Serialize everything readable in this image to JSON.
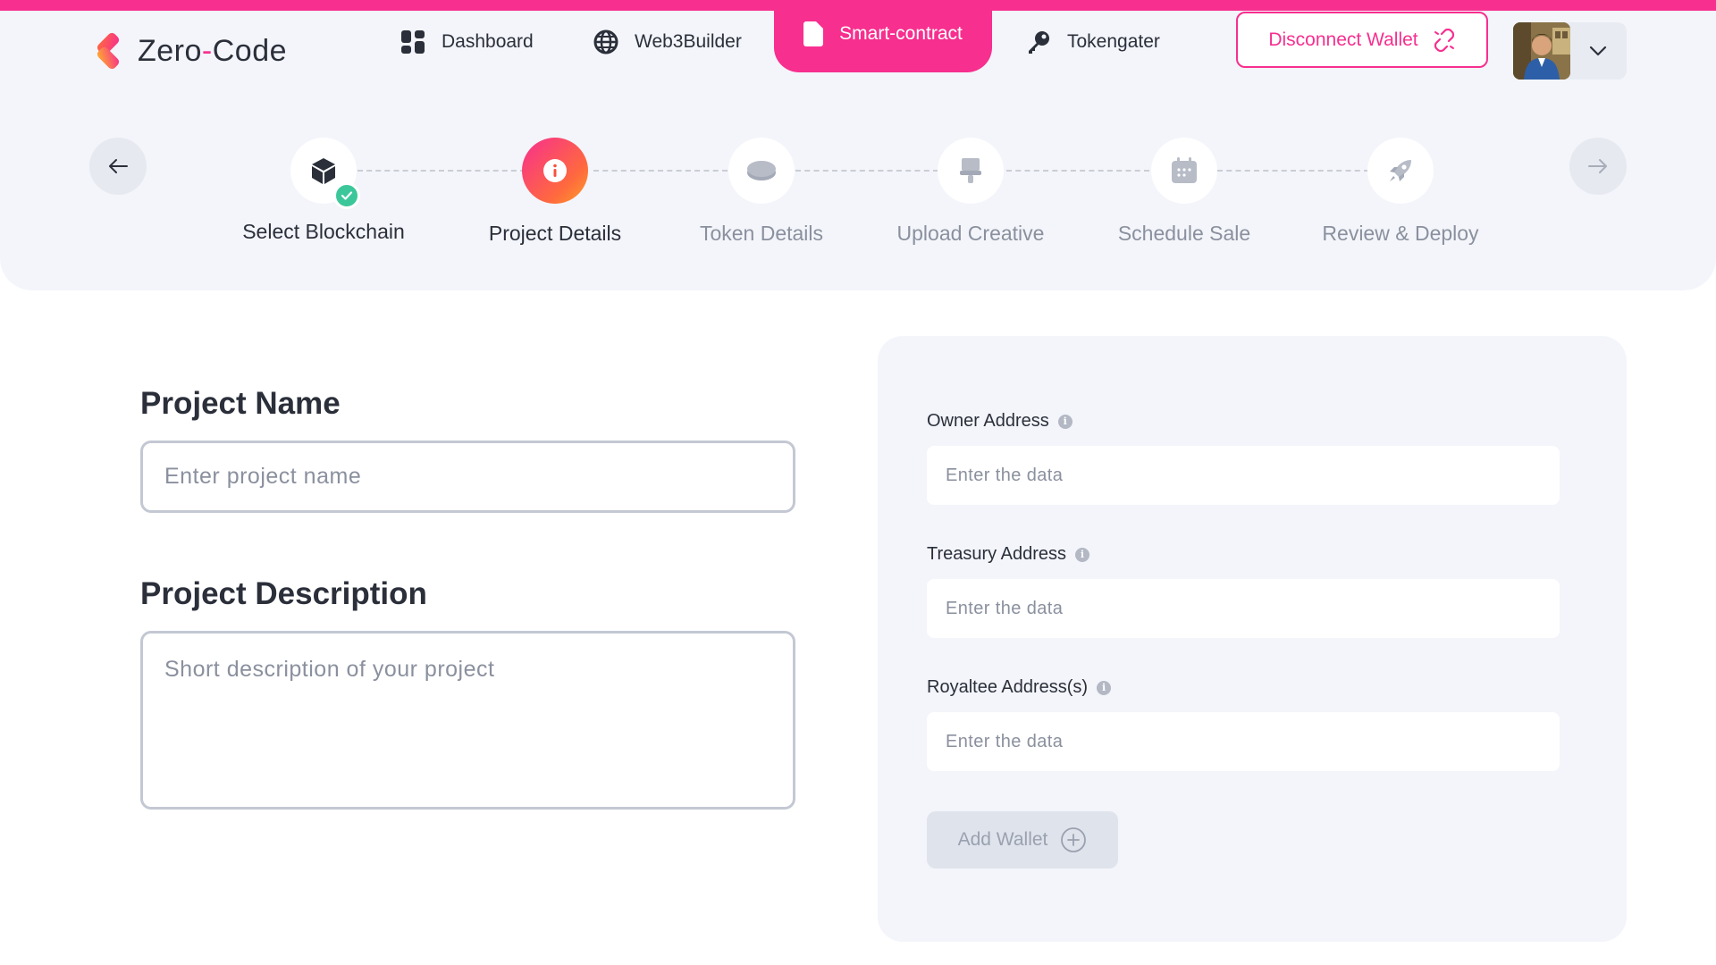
{
  "brand": {
    "name_left": "Zero",
    "name_dash": "-",
    "name_right": "Code"
  },
  "nav": {
    "dashboard": "Dashboard",
    "web3builder": "Web3Builder",
    "smart_contract": "Smart-contract",
    "tokengater": "Tokengater"
  },
  "wallet": {
    "disconnect_label": "Disconnect Wallet"
  },
  "stepper": {
    "steps": [
      {
        "label": "Select Blockchain",
        "status": "done",
        "icon": "cube-icon"
      },
      {
        "label": "Project Details",
        "status": "current",
        "icon": "info-icon"
      },
      {
        "label": "Token Details",
        "status": "pending",
        "icon": "coin-icon"
      },
      {
        "label": "Upload Creative",
        "status": "pending",
        "icon": "brush-icon"
      },
      {
        "label": "Schedule Sale",
        "status": "pending",
        "icon": "calendar-icon"
      },
      {
        "label": "Review & Deploy",
        "status": "pending",
        "icon": "rocket-icon"
      }
    ]
  },
  "project": {
    "name_title": "Project Name",
    "name_placeholder": "Enter project name",
    "description_title": "Project Description",
    "description_placeholder": "Short description of your project"
  },
  "addresses": {
    "owner_label": "Owner Address",
    "treasury_label": "Treasury Address",
    "royaltee_label": "Royaltee Address(s)",
    "placeholder": "Enter the data",
    "add_wallet_label": "Add Wallet"
  },
  "colors": {
    "accent": "#f72f8f",
    "success": "#3cc79a",
    "panel_bg": "#f3f5fa"
  }
}
